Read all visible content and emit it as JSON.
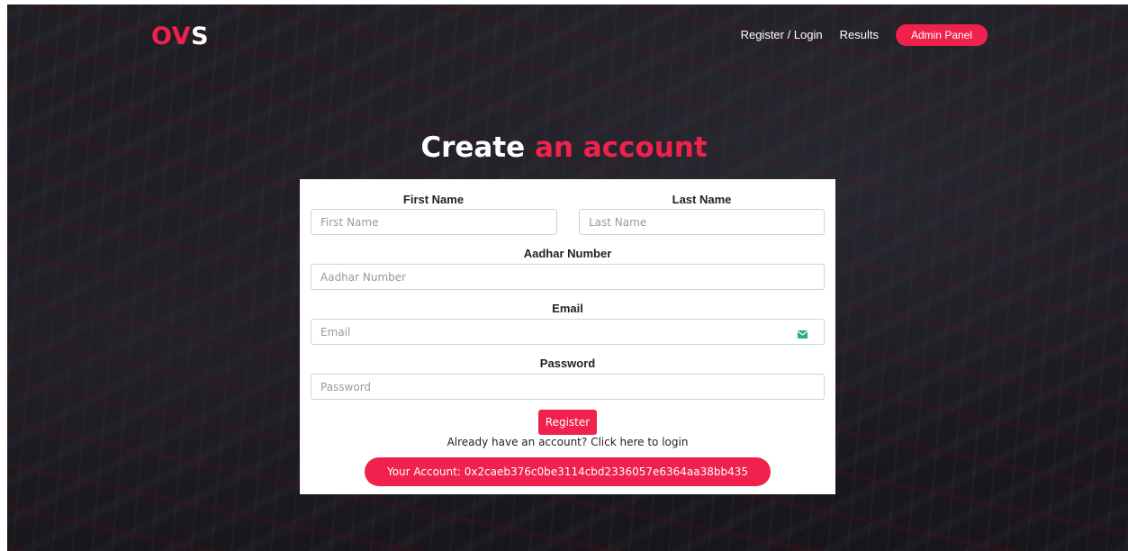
{
  "brand": {
    "logo_accent": "OV",
    "logo_rest": "S",
    "accent_color": "#f0214c"
  },
  "nav": {
    "register_login": "Register / Login",
    "results": "Results",
    "admin_panel": "Admin Panel"
  },
  "heading": {
    "part1": "Create",
    "part2": "an account"
  },
  "form": {
    "first_name_label": "First Name",
    "first_name_placeholder": "First Name",
    "last_name_label": "Last Name",
    "last_name_placeholder": "Last Name",
    "aadhar_label": "Aadhar Number",
    "aadhar_placeholder": "Aadhar Number",
    "email_label": "Email",
    "email_placeholder": "Email",
    "email_icon": "mail-icon",
    "password_label": "Password",
    "password_placeholder": "Password",
    "register_button": "Register",
    "login_prompt": "Already have an account? Click here to login",
    "account_text": "Your Account: 0x2caeb376c0be3114cbd2336057e6364aa38bb435"
  }
}
